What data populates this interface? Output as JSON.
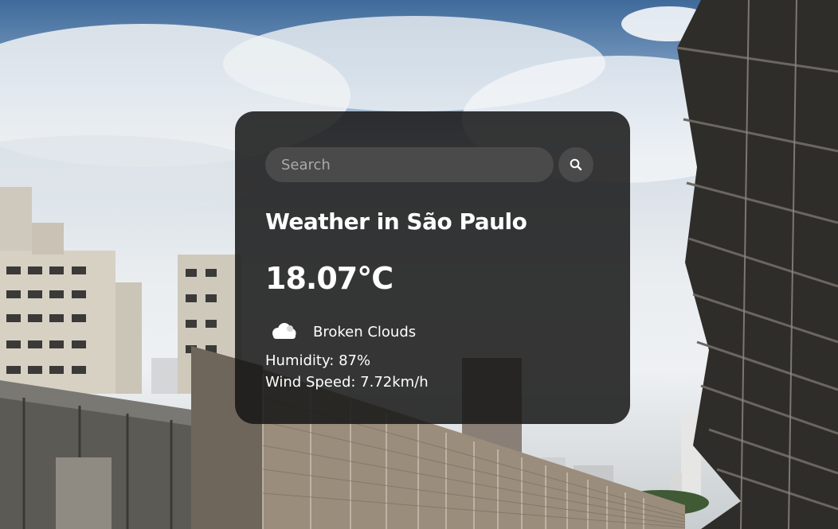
{
  "search": {
    "placeholder": "Search",
    "value": ""
  },
  "weather": {
    "city_heading": "Weather in São Paulo",
    "temperature": "18.07°C",
    "description": "Broken Clouds",
    "humidity": "Humidity: 87%",
    "wind_speed": "Wind Speed: 7.72km/h"
  },
  "icons": {
    "search": "search-icon",
    "weather": "cloud-icon",
    "weather_icon_color": "#ffffff"
  },
  "colors": {
    "card_background": "rgba(22,22,22,0.86)",
    "input_background": "#4a4a4a",
    "text": "#ffffff",
    "placeholder": "#a9a9a9"
  }
}
